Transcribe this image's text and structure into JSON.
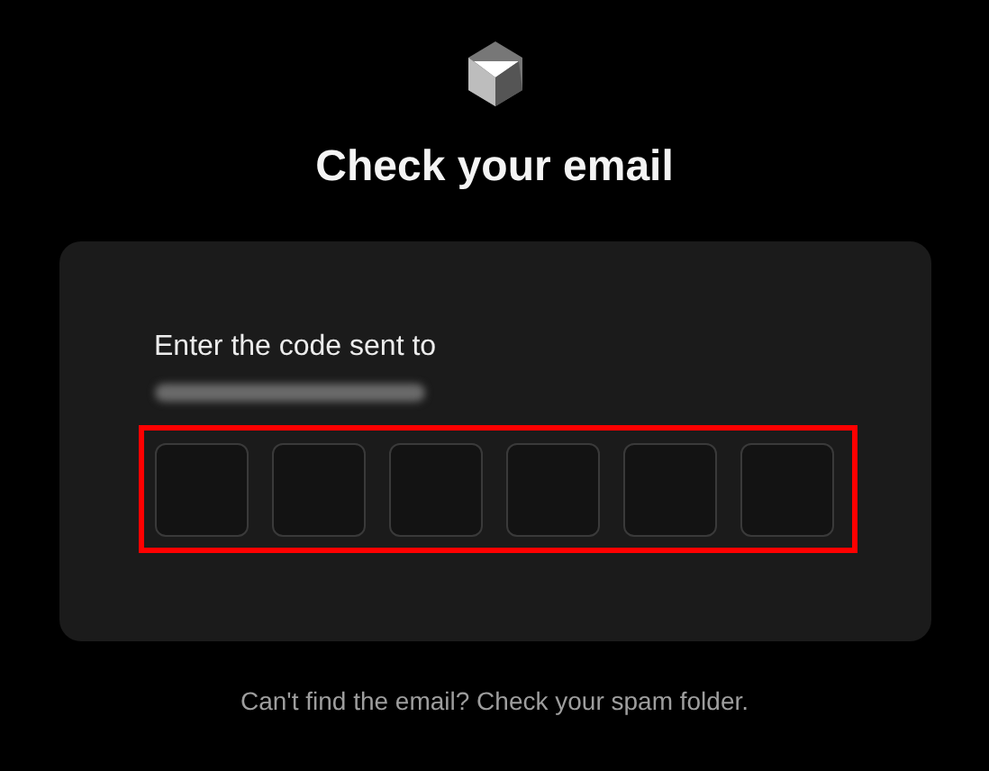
{
  "title": "Check your email",
  "card": {
    "label": "Enter the code sent to",
    "email_redacted": true,
    "code_inputs": {
      "highlighted": true,
      "digits": [
        {
          "filled": false
        },
        {
          "filled": false
        },
        {
          "filled": false
        },
        {
          "filled": false
        },
        {
          "filled": false
        },
        {
          "filled": false
        }
      ]
    }
  },
  "footer": "Can't find the email? Check your spam folder."
}
